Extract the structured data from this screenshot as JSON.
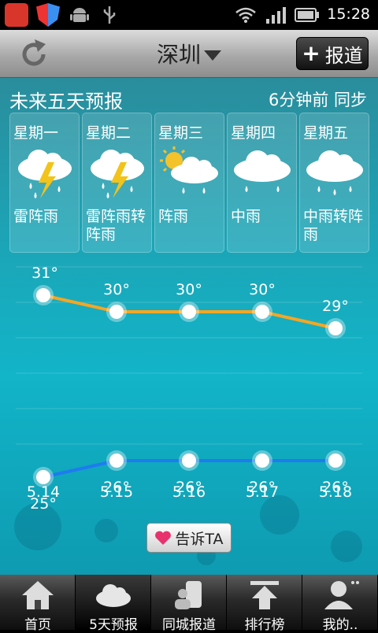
{
  "status_bar": {
    "time": "15:28"
  },
  "title_bar": {
    "city": "深圳",
    "report_label": "报道"
  },
  "main": {
    "title": "未来五天预报",
    "sync_text": "6分钟前 同步",
    "days": [
      {
        "name": "星期一",
        "condition": "雷阵雨",
        "icon": "thunderstorm-icon"
      },
      {
        "name": "星期二",
        "condition": "雷阵雨转阵雨",
        "icon": "thunderstorm-icon"
      },
      {
        "name": "星期三",
        "condition": "阵雨",
        "icon": "sun-cloud-rain-icon"
      },
      {
        "name": "星期四",
        "condition": "中雨",
        "icon": "cloud-rain-icon"
      },
      {
        "name": "星期五",
        "condition": "中雨转阵雨",
        "icon": "cloud-rain-icon"
      }
    ],
    "tell_label": "告诉TA"
  },
  "chart_data": {
    "type": "line",
    "categories": [
      "5.14",
      "5.15",
      "5.16",
      "5.17",
      "5.18"
    ],
    "series": [
      {
        "values": [
          31,
          30,
          30,
          30,
          29
        ],
        "color": "#f5a623",
        "labels": [
          "31°",
          "30°",
          "30°",
          "30°",
          "29°"
        ]
      },
      {
        "values": [
          25,
          26,
          26,
          26,
          26
        ],
        "color": "#1e7bf0",
        "labels": [
          "25°",
          "26°",
          "26°",
          "26°",
          "26°"
        ]
      }
    ]
  },
  "bottom_nav": {
    "items": [
      {
        "label": "首页",
        "icon": "home-icon"
      },
      {
        "label": "5天预报",
        "icon": "cloud-icon",
        "active": true
      },
      {
        "label": "同城报道",
        "icon": "camera-person-icon"
      },
      {
        "label": "排行榜",
        "icon": "upload-arrow-icon"
      },
      {
        "label": "我的..",
        "icon": "user-icon"
      }
    ]
  }
}
